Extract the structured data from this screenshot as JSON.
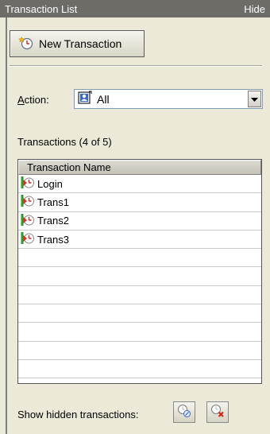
{
  "panel": {
    "title": "Transaction List",
    "hide_label": "Hide"
  },
  "toolbar": {
    "new_transaction_label": "New Transaction"
  },
  "action": {
    "label_prefix": "A",
    "label_rest": "ction:",
    "selected": "All"
  },
  "transactions": {
    "count_label": "Transactions (4 of 5)",
    "column_header": "Transaction Name",
    "rows": [
      "Login",
      "Trans1",
      "Trans2",
      "Trans3",
      "",
      "",
      "",
      "",
      "",
      "",
      ""
    ]
  },
  "footer": {
    "show_hidden_label": "Show hidden transactions:"
  },
  "colors": {
    "panel_bg": "#ece9d8",
    "titlebar_bg": "#6d6c67",
    "grid_border": "#555555"
  },
  "icons": {
    "new_transaction": "new-transaction-icon",
    "action_all": "action-user-icon",
    "transaction_row": "transaction-icon",
    "show_hidden": "show-hidden-icon",
    "delete_hidden": "delete-hidden-icon"
  }
}
